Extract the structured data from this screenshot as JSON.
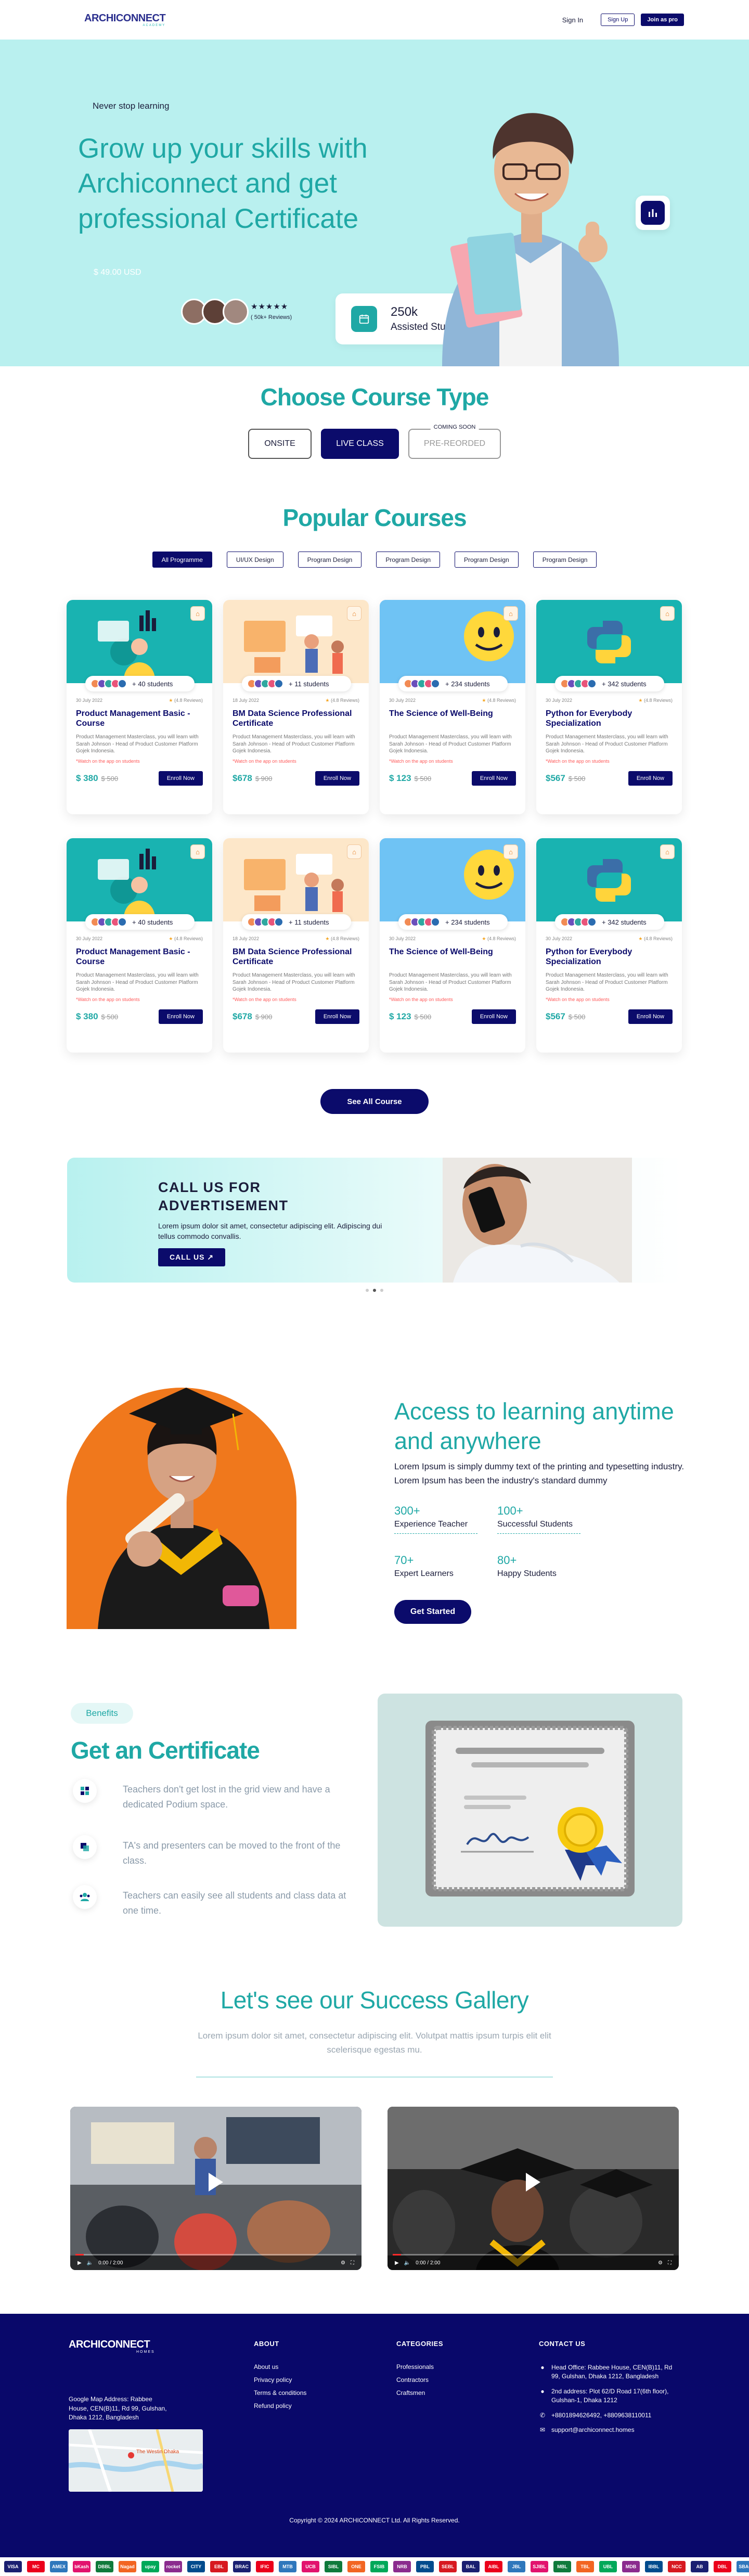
{
  "nav": {
    "logo": "ARCHICONNECT",
    "logo_sub": "ACADEMY",
    "signin": "Sign In",
    "signup": "Sign Up",
    "joinpro": "Join as pro"
  },
  "hero": {
    "kicker": "Never stop learning",
    "title": "Grow up your skills with Archiconnect and get professional Certificate",
    "price": "$ 49.00 USD",
    "stars": "★★★★★",
    "reviews": "( 50k+ Reviews)",
    "stat_value": "250k",
    "stat_label": "Assisted Student"
  },
  "course_type": {
    "title": "Choose Course Type",
    "onsite": "ONSITE",
    "live": "LIVE CLASS",
    "prerecorded": "PRE-REORDED",
    "soon": "COMING SOON"
  },
  "popular": {
    "title": "Popular Courses",
    "filters": [
      "All Programme",
      "UI/UX Design",
      "Program Design",
      "Program Design",
      "Program Design",
      "Program Design"
    ],
    "enroll": "Enroll Now",
    "see_all": "See All Course",
    "cards": [
      {
        "students": "+ 40 students",
        "date": "30 July 2022",
        "reviews": "(4.8 Reviews)",
        "title": "Product Management Basic - Course",
        "desc": "Product Management Masterclass, you will learn with Sarah Johnson - Head of Product Customer Platform Gojek Indonesia.",
        "rev": "*Watch on the app on students",
        "price": "$ 380",
        "old": "$ 500",
        "bg": "teal"
      },
      {
        "students": "+ 11 students",
        "date": "18 July 2022",
        "reviews": "(4.8 Reviews)",
        "title": "BM Data Science Professional Certificate",
        "desc": "Product Management Masterclass, you will learn with Sarah Johnson - Head of Product Customer Platform Gojek Indonesia.",
        "rev": "*Watch on the app on students",
        "price": "$678",
        "old": "$ 900",
        "bg": "peach"
      },
      {
        "students": "+ 234 students",
        "date": "30 July 2022",
        "reviews": "(4.8 Reviews)",
        "title": "The Science of Well-Being",
        "desc": "Product Management Masterclass, you will learn with Sarah Johnson - Head of Product Customer Platform Gojek Indonesia.",
        "rev": "*Watch on the app on students",
        "price": "$ 123",
        "old": "$ 500",
        "bg": "sky"
      },
      {
        "students": "+ 342 students",
        "date": "30 July 2022",
        "reviews": "(4.8 Reviews)",
        "title": "Python for Everybody Specialization",
        "desc": "Product Management Masterclass, you will learn with Sarah Johnson - Head of Product Customer Platform Gojek Indonesia.",
        "rev": "*Watch on the app on students",
        "price": "$567",
        "old": "$ 500",
        "bg": "teal"
      },
      {
        "students": "+ 40 students",
        "date": "30 July 2022",
        "reviews": "(4.8 Reviews)",
        "title": "Product Management Basic - Course",
        "desc": "Product Management Masterclass, you will learn with Sarah Johnson - Head of Product Customer Platform Gojek Indonesia.",
        "rev": "*Watch on the app on students",
        "price": "$ 380",
        "old": "$ 500",
        "bg": "teal"
      },
      {
        "students": "+ 11 students",
        "date": "18 July 2022",
        "reviews": "(4.8 Reviews)",
        "title": "BM Data Science Professional Certificate",
        "desc": "Product Management Masterclass, you will learn with Sarah Johnson - Head of Product Customer Platform Gojek Indonesia.",
        "rev": "*Watch on the app on students",
        "price": "$678",
        "old": "$ 900",
        "bg": "peach"
      },
      {
        "students": "+ 234 students",
        "date": "30 July 2022",
        "reviews": "(4.8 Reviews)",
        "title": "The Science of Well-Being",
        "desc": "Product Management Masterclass, you will learn with Sarah Johnson - Head of Product Customer Platform Gojek Indonesia.",
        "rev": "*Watch on the app on students",
        "price": "$ 123",
        "old": "$ 500",
        "bg": "sky"
      },
      {
        "students": "+ 342 students",
        "date": "30 July 2022",
        "reviews": "(4.8 Reviews)",
        "title": "Python for Everybody Specialization",
        "desc": "Product Management Masterclass, you will learn with Sarah Johnson - Head of Product Customer Platform Gojek Indonesia.",
        "rev": "*Watch on the app on students",
        "price": "$567",
        "old": "$ 500",
        "bg": "teal"
      }
    ]
  },
  "advert": {
    "title_1": "CALL US FOR",
    "title_2": "ADVERTISEMENT",
    "text": "Lorem ipsum dolor sit amet, consectetur adipiscing elit. Adipiscing dui tellus commodo convallis.",
    "button": "CALL US ↗"
  },
  "access": {
    "title": "Access to learning anytime and anywhere",
    "text": "Lorem Ipsum is simply dummy text of the printing and typesetting industry. Lorem Ipsum has been the industry's standard dummy",
    "stats": [
      {
        "num": "300+",
        "label": "Experience Teacher"
      },
      {
        "num": "100+",
        "label": "Successful Students"
      },
      {
        "num": "70+",
        "label": "Expert  Learners"
      },
      {
        "num": "80+",
        "label": "Happy Students"
      }
    ],
    "button": "Get Started"
  },
  "certificate": {
    "badge": "Benefits",
    "title": "Get an Certificate",
    "features": [
      "Teachers don't get lost in the grid view and have a dedicated Podium space.",
      "TA's and presenters can be moved to the front of the class.",
      "Teachers can easily see all students and class data at one time."
    ]
  },
  "gallery": {
    "title": "Let's see our Success Gallery",
    "text": "Lorem ipsum dolor sit amet, consectetur adipiscing elit. Volutpat mattis ipsum turpis elit elit scelerisque egestas mu.",
    "time": "0:00 / 2:00"
  },
  "footer": {
    "logo": "ARCHICONNECT",
    "logo_sub": "HOMES",
    "address": "Google Map Address: Rabbee House, CEN(B)11, Rd 99, Gulshan, Dhaka 1212, Bangladesh",
    "about_title": "ABOUT",
    "about": [
      "About us",
      "Privacy policy",
      "Terms & conditions",
      "Refund policy"
    ],
    "cat_title": "CATEGORIES",
    "categories": [
      "Professionals",
      "Contractors",
      "Craftsmen"
    ],
    "contact_title": "CONTACT US",
    "contact": [
      "Head Office: Rabbee House, CEN(B)11, Rd 99, Gulshan, Dhaka 1212, Bangladesh",
      "2nd address: Plot 62/D Road 17(6th floor), Gulshan-1, Dhaka 1212",
      "+8801894626492, +8809638110011",
      "support@archiconnect.homes"
    ],
    "copyright": "Copyright © 2024 ARCHICONNECT Ltd. All Rights Reserved.",
    "map_label": "The Westin Dhaka"
  },
  "payments": [
    "VISA",
    "MC",
    "AMEX",
    "bKash",
    "DBBL",
    "Nagad",
    "upay",
    "rocket",
    "CITY",
    "EBL",
    "BRAC",
    "IFIC",
    "MTB",
    "UCB",
    "SIBL",
    "ONE",
    "FSIB",
    "NRB",
    "PBL",
    "SEBL",
    "BAL",
    "AIBL",
    "JBL",
    "SJIBL",
    "MBL",
    "TBL",
    "UBL",
    "MDB",
    "IBBL",
    "NCC",
    "AB",
    "DBL",
    "SBAC",
    "OBL",
    "PRIME",
    "HSBC",
    "SCB",
    "BDBL",
    "JAMUNA",
    "Dutch"
  ],
  "colors": {
    "teal": "#1fa8a5",
    "navy": "#0b0b6b",
    "hero_bg": "#b9f0ef",
    "orange": "#f0781c"
  }
}
